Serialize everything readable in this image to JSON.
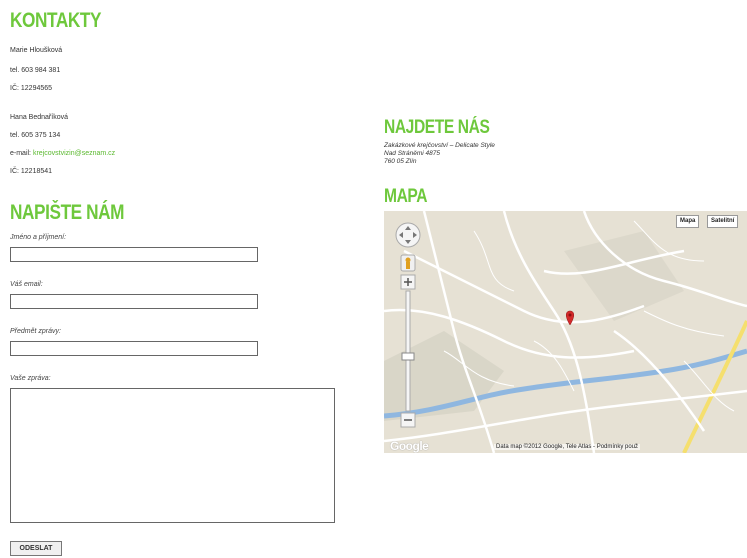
{
  "contacts": {
    "heading": "KONTAKTY",
    "person1": {
      "name": "Marie Hloušková",
      "phone": "tel. 603 984 381",
      "ic": "IČ: 12294565"
    },
    "person2": {
      "name": "Hana Bednaříková",
      "phone": "tel. 605 375 134",
      "email_label": "e-mail:",
      "email": "krejcovstvizin@seznam.cz",
      "ic": "IČ: 12218541"
    }
  },
  "form": {
    "heading": "NAPIŠTE NÁM",
    "name_label": "Jméno a příjmení:",
    "email_label": "Váš email:",
    "subject_label": "Předmět zprávy:",
    "message_label": "Vaše zpráva:",
    "submit_label": "ODESLAT"
  },
  "find_us": {
    "heading": "NAJDETE NÁS",
    "line1": "Zakázkové krejčovství – Delicate Style",
    "line2": "Nad Stráněmi 4875",
    "line3": "760 05 Zlín"
  },
  "map": {
    "heading": "MAPA",
    "btn_map": "Mapa",
    "btn_satellite": "Satelitní",
    "google_logo": "Google",
    "attribution": "Data map ©2012 Google, Tele Atlas - Podmínky použ"
  },
  "colors": {
    "accent": "#6ec83c",
    "road": "#ffffff",
    "land": "#e8e4d9",
    "river": "#8fb7e0"
  }
}
